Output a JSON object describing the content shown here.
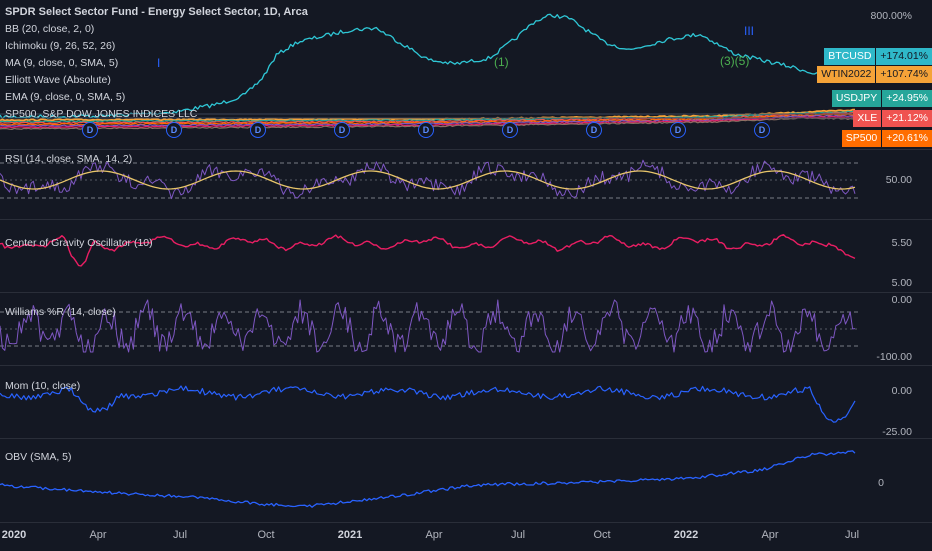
{
  "main_pane": {
    "title": "SPDR Select Sector Fund - Energy Select Sector, 1D, Arca",
    "indicators": [
      "BB (20, close, 2, 0)",
      "Ichimoku (9, 26, 52, 26)",
      "MA (9, close, 0, SMA, 5)",
      "Elliott Wave (Absolute)",
      "EMA (9, close, 0, SMA, 5)",
      "SP500, S&P DOW JONES INDICES LLC"
    ],
    "axis_top_label": "800.00%",
    "wave_labels": [
      "I",
      "(1)",
      "(3)(5)",
      "III"
    ],
    "dividend_marker": "D",
    "compare_badges": [
      {
        "symbol": "BTCUSD",
        "value": "+174.01%",
        "color": "#2fb8c9"
      },
      {
        "symbol": "WTIN2022",
        "value": "+107.74%",
        "color": "#f5a338"
      },
      {
        "symbol": "USDJPY",
        "value": "+24.95%",
        "color": "#26a69a"
      },
      {
        "symbol": "XLE",
        "value": "+21.12%",
        "color": "#ef5350"
      },
      {
        "symbol": "SP500",
        "value": "+20.61%",
        "color": "#ff6d00"
      }
    ]
  },
  "rsi_pane": {
    "label": "RSI (14, close, SMA, 14, 2)",
    "axis": [
      "50.00"
    ]
  },
  "cog_pane": {
    "label": "Center of Gravity Oscillator (10)",
    "axis": [
      "5.50",
      "5.00"
    ]
  },
  "wpr_pane": {
    "label": "Williams %R (14, close)",
    "axis": [
      "0.00",
      "-100.00"
    ]
  },
  "mom_pane": {
    "label": "Mom (10, close)",
    "axis": [
      "0.00",
      "-25.00"
    ]
  },
  "obv_pane": {
    "label": "OBV (SMA, 5)",
    "axis": [
      "0"
    ]
  },
  "time_axis": [
    {
      "label": "2020",
      "year": true
    },
    {
      "label": "Apr",
      "year": false
    },
    {
      "label": "Jul",
      "year": false
    },
    {
      "label": "Oct",
      "year": false
    },
    {
      "label": "2021",
      "year": true
    },
    {
      "label": "Apr",
      "year": false
    },
    {
      "label": "Jul",
      "year": false
    },
    {
      "label": "Oct",
      "year": false
    },
    {
      "label": "2022",
      "year": true
    },
    {
      "label": "Apr",
      "year": false
    },
    {
      "label": "Jul",
      "year": false
    }
  ],
  "colors": {
    "background": "#141823",
    "btc_line": "#2fc7d6",
    "rsi_line": "#7e57c2",
    "rsi_ma": "#e8c56a",
    "cog_line": "#e91e63",
    "wpr_line": "#7e57c2",
    "mom_line": "#2962ff",
    "obv_line": "#2962ff"
  }
}
